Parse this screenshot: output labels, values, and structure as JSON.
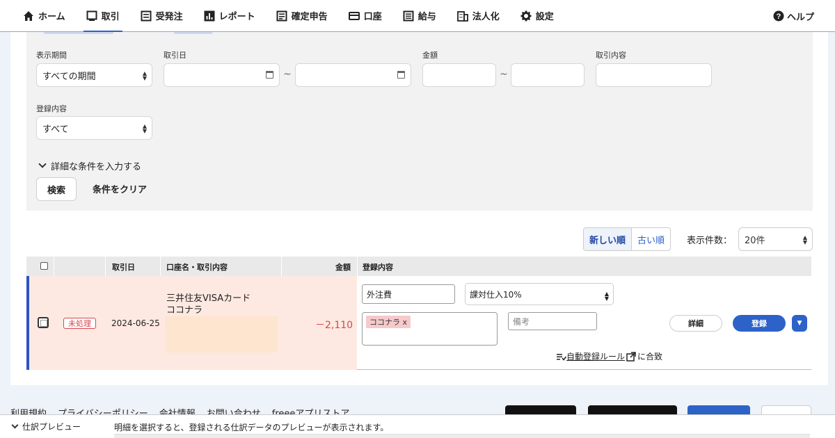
{
  "nav": {
    "items": [
      {
        "label": "ホーム",
        "icon": "home-icon"
      },
      {
        "label": "取引",
        "icon": "transaction-icon",
        "active": true
      },
      {
        "label": "受発注",
        "icon": "order-icon"
      },
      {
        "label": "レポート",
        "icon": "report-icon"
      },
      {
        "label": "確定申告",
        "icon": "tax-return-icon"
      },
      {
        "label": "口座",
        "icon": "account-card-icon"
      },
      {
        "label": "給与",
        "icon": "payroll-icon"
      },
      {
        "label": "法人化",
        "icon": "building-icon"
      },
      {
        "label": "設定",
        "icon": "gear-icon"
      }
    ],
    "help": "ヘルプ"
  },
  "filter": {
    "period_label": "表示期間",
    "period_value": "すべての期間",
    "date_label": "取引日",
    "amount_label": "金額",
    "content_label": "取引内容",
    "reg_label": "登録内容",
    "reg_value": "すべて",
    "tilde": "~",
    "detail_toggle": "詳細な条件を入力する",
    "search_button": "検索",
    "clear_button": "条件をクリア"
  },
  "list": {
    "sort_new": "新しい順",
    "sort_old": "古い順",
    "perpage_label": "表示件数：",
    "perpage_value": "20件",
    "headers": {
      "date": "取引日",
      "account": "口座名・取引内容",
      "amount": "金額",
      "registration": "登録内容"
    },
    "rows": [
      {
        "status": "未処理",
        "date": "2024-06-25",
        "account": "三井住友VISAカード",
        "description": "ココナラ",
        "amount": "－2,110",
        "category": "外注費",
        "tax": "課対仕入10%",
        "partner_tag": "ココナラ x",
        "memo_placeholder": "備考",
        "rule_link": "自動登録ルール",
        "rule_suffix": "に合致",
        "detail_button": "詳細",
        "register_button": "登録"
      }
    ]
  },
  "footer": {
    "links": [
      "利用規約",
      "プライバシーポリシー",
      "会社情報",
      "お問い合わせ",
      "freeeアプリストア"
    ]
  },
  "preview": {
    "title": "仕訳プレビュー",
    "message": "明細を選択すると、登録される仕訳データのプレビューが表示されます。"
  },
  "colors": {
    "accent": "#2d62c8",
    "unprocessed": "#d6464d",
    "row_bg": "#fde9e1"
  }
}
